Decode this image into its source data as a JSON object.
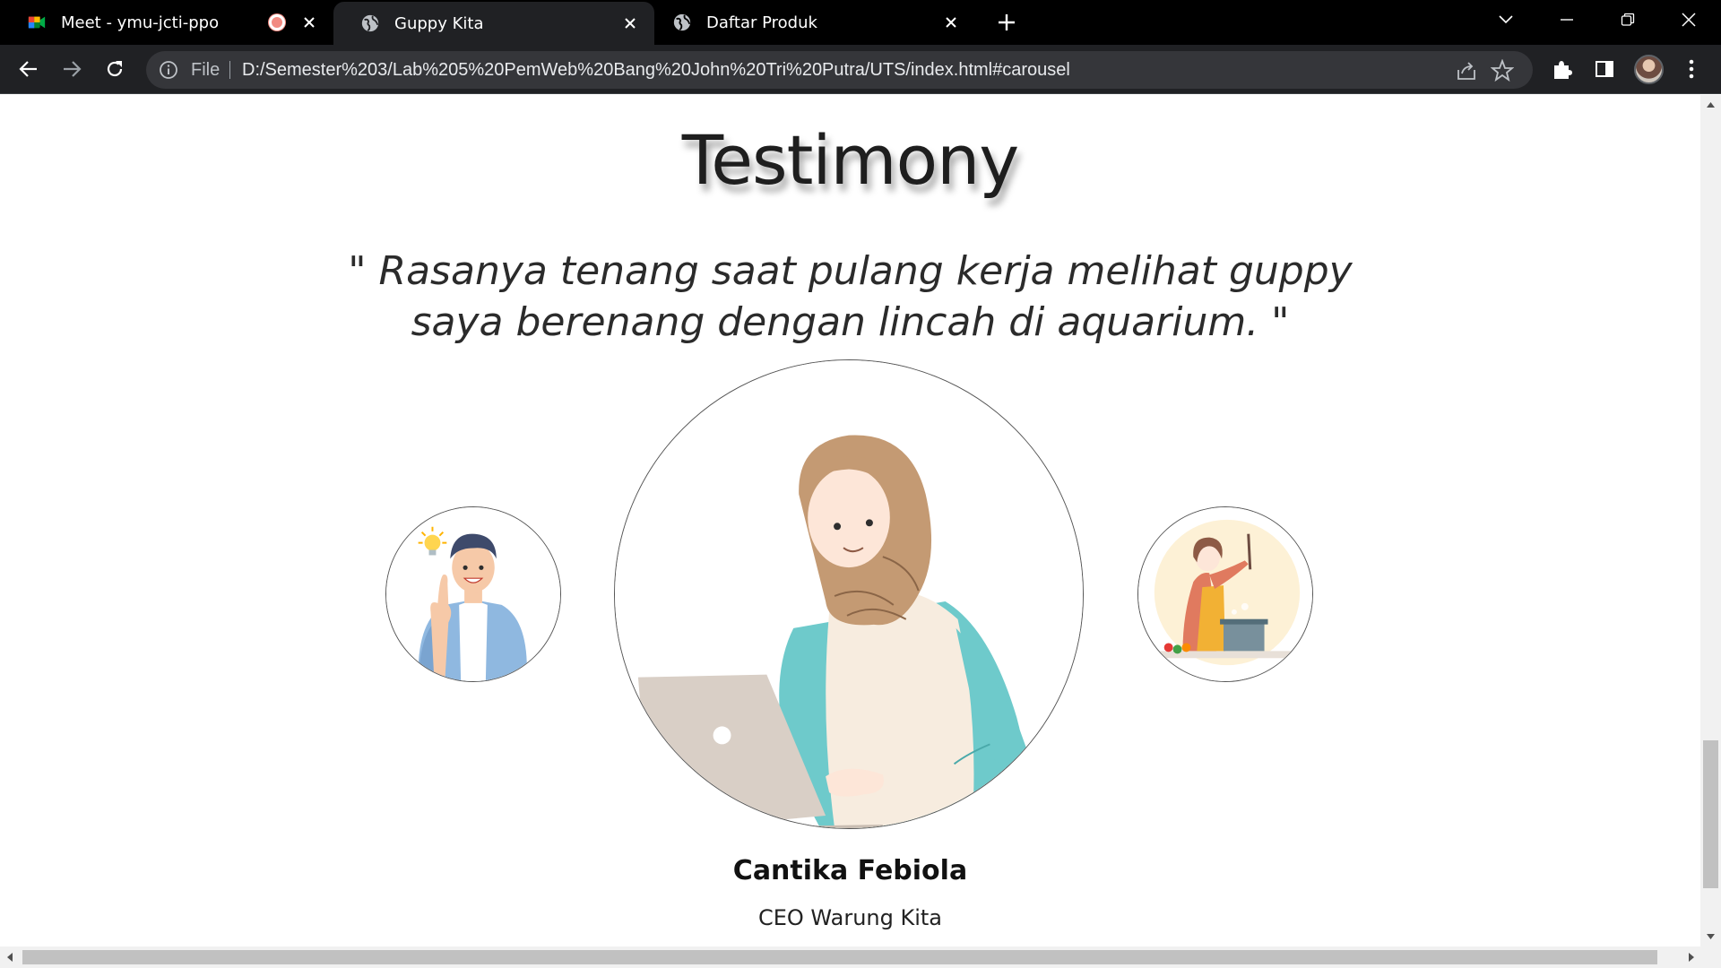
{
  "browser": {
    "tabs": [
      {
        "title": "Meet - ymu-jcti-ppo",
        "icon": "google-meet-icon",
        "recording": true,
        "active": false
      },
      {
        "title": "Guppy Kita",
        "icon": "globe-icon",
        "active": true
      },
      {
        "title": "Daftar Produk",
        "icon": "globe-icon",
        "active": false
      }
    ],
    "omnibox": {
      "scheme_label": "File",
      "url": "D:/Semester%203/Lab%205%20PemWeb%20Bang%20John%20Tri%20Putra/UTS/index.html#carousel"
    }
  },
  "page": {
    "heading": "Testimony",
    "quote": "\" Rasanya tenang saat pulang kerja melihat guppy saya berenang dengan lincah di aquarium. \"",
    "testimonial": {
      "name": "Cantika Febiola",
      "role": "CEO Warung Kita"
    }
  },
  "colors": {
    "tabbar": "#000000",
    "toolbar": "#202124",
    "omnibox": "#35363a",
    "skin": "#fde6d8",
    "hijab": "#c49a73",
    "sweater": "#f7ecdf",
    "sleeve": "#6ecacb",
    "laptop": "#d9cfc6"
  },
  "scroll": {
    "vertical_position": 0.85,
    "horizontal_position": 0.0
  }
}
